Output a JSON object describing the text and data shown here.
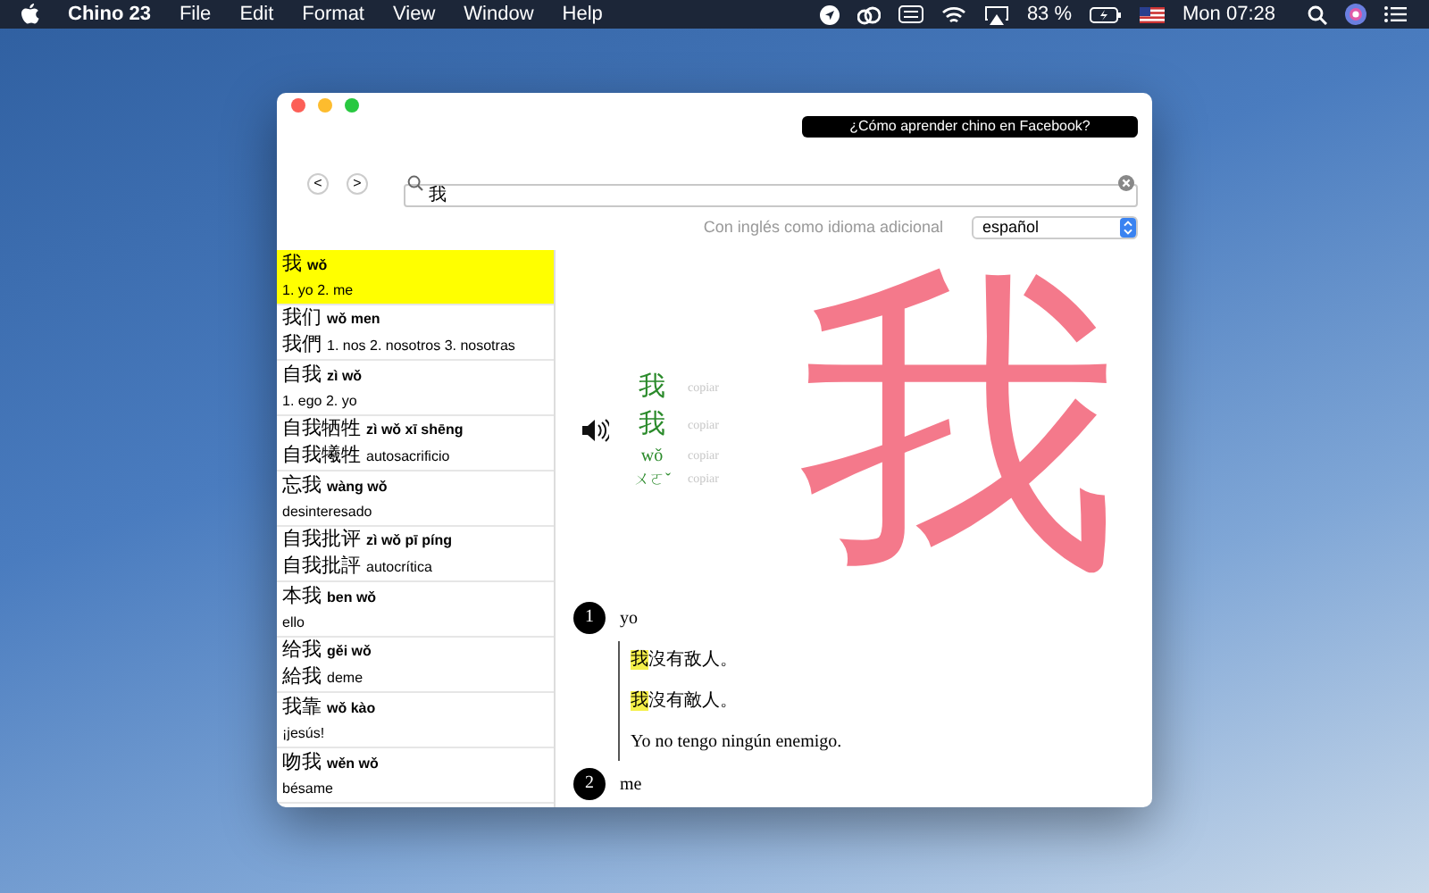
{
  "menu_bar": {
    "app_name": "Chino 23",
    "menus": [
      "File",
      "Edit",
      "Format",
      "View",
      "Window",
      "Help"
    ],
    "battery_text": "83 %",
    "clock": "Mon 07:28"
  },
  "window": {
    "facebook_button": "¿Cómo aprender chino en Facebook?",
    "nav": [
      "<",
      ">"
    ],
    "search": {
      "value": "我"
    },
    "language_label": "Con inglés como idioma adicional",
    "language_select": "español",
    "results": [
      {
        "hanzi": "我",
        "pinyin": "wǒ",
        "meaning": "1. yo 2. me",
        "selected": true
      },
      {
        "hanzi": "我们",
        "pinyin": "wǒ men",
        "traditional": "我們",
        "meaning": "1. nos 2. nosotros 3. nosotras",
        "selected": false
      },
      {
        "hanzi": "自我",
        "pinyin": "zì wǒ",
        "meaning": "1. ego 2. yo",
        "selected": false
      },
      {
        "hanzi": "自我牺牲",
        "pinyin": "zì wǒ xī shēng",
        "traditional": "自我犧牲",
        "meaning": "autosacrificio",
        "selected": false
      },
      {
        "hanzi": "忘我",
        "pinyin": "wàng wǒ",
        "meaning": "desinteresado",
        "selected": false
      },
      {
        "hanzi": "自我批评",
        "pinyin": "zì wǒ pī píng",
        "traditional": "自我批評",
        "meaning": "autocrítica",
        "selected": false
      },
      {
        "hanzi": "本我",
        "pinyin": "ben wǒ",
        "meaning": "ello",
        "selected": false
      },
      {
        "hanzi": "给我",
        "pinyin": "gěi wǒ",
        "traditional": "給我",
        "meaning": "deme",
        "selected": false
      },
      {
        "hanzi": "我靠",
        "pinyin": "wǒ kào",
        "meaning": "¡jesús!",
        "selected": false
      },
      {
        "hanzi": "吻我",
        "pinyin": "wěn wǒ",
        "meaning": "bésame",
        "selected": false
      }
    ],
    "detail": {
      "forms": [
        {
          "kind": "hanzi",
          "text": "我",
          "copy": "copiar"
        },
        {
          "kind": "hanzi",
          "text": "我",
          "copy": "copiar"
        },
        {
          "kind": "pinyin",
          "text": "wǒ",
          "copy": "copiar"
        },
        {
          "kind": "zhuyin",
          "text": "ㄨㄛˇ",
          "copy": "copiar"
        }
      ],
      "big_character": "我",
      "senses": [
        {
          "number": "1",
          "meaning": "yo",
          "examples": [
            {
              "highlight": "我",
              "rest": "沒有敌人。"
            },
            {
              "highlight": "我",
              "rest": "沒有敵人。"
            }
          ],
          "translation": "Yo no tengo ningún enemigo."
        },
        {
          "number": "2",
          "meaning": "me"
        }
      ]
    }
  }
}
